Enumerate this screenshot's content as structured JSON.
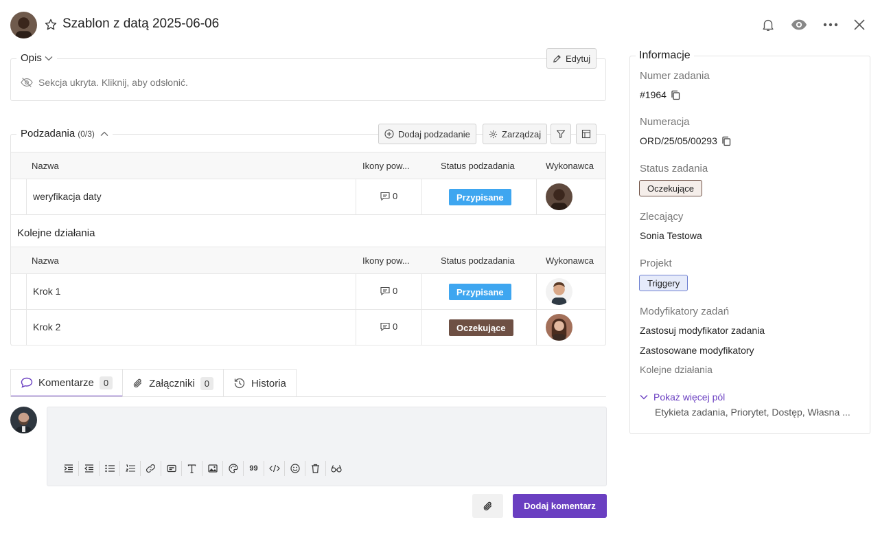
{
  "header": {
    "title": "Szablon z datą 2025-06-06"
  },
  "description": {
    "label": "Opis",
    "edit_label": "Edytuj",
    "hidden_text": "Sekcja ukryta. Kliknij, aby odsłonić."
  },
  "subtasks": {
    "label": "Podzadania",
    "count": "(0/3)",
    "add_label": "Dodaj podzadanie",
    "manage_label": "Zarządzaj",
    "columns": [
      "Nazwa",
      "Ikony pow...",
      "Status podzadania",
      "Wykonawca"
    ],
    "rows": [
      {
        "name": "weryfikacja daty",
        "comments": "0",
        "status": "Przypisane"
      }
    ]
  },
  "next_actions": {
    "label": "Kolejne działania",
    "columns": [
      "Nazwa",
      "Ikony pow...",
      "Status podzadania",
      "Wykonawca"
    ],
    "rows": [
      {
        "name": "Krok 1",
        "comments": "0",
        "status": "Przypisane"
      },
      {
        "name": "Krok 2",
        "comments": "0",
        "status": "Oczekujące"
      }
    ]
  },
  "tabs": [
    {
      "label": "Komentarze",
      "count": "0"
    },
    {
      "label": "Załączniki",
      "count": "0"
    },
    {
      "label": "Historia"
    }
  ],
  "comment": {
    "submit_label": "Dodaj komentarz",
    "toolbar_icons": [
      "indent-icon",
      "outdent-icon",
      "bullet-list-icon",
      "numbered-list-icon",
      "link-icon",
      "card-icon",
      "text-format-icon",
      "image-icon",
      "palette-icon",
      "quote-icon",
      "code-icon",
      "emoji-icon",
      "trash-icon",
      "preview-icon"
    ],
    "quote_glyph": "99"
  },
  "info": {
    "title": "Informacje",
    "task_number_label": "Numer zadania",
    "task_number": "#1964",
    "numbering_label": "Numeracja",
    "numbering": "ORD/25/05/00293",
    "status_label": "Status zadania",
    "status": "Oczekujące",
    "requester_label": "Zlecający",
    "requester": "Sonia Testowa",
    "project_label": "Projekt",
    "project": "Triggery",
    "modifiers_label": "Modyfikatory zadań",
    "apply_modifier": "Zastosuj modyfikator zadania",
    "applied_modifiers": "Zastosowane modyfikatory",
    "next_actions": "Kolejne działania",
    "show_more": "Pokaż więcej pól",
    "more_fields": "Etykieta zadania, Priorytet, Dostęp, Własna ..."
  },
  "colors": {
    "accent": "#6a3fc1",
    "assigned": "#3ea6f0",
    "pending": "#6e5044",
    "pending_tag_bg": "#f5eeea",
    "project_tag_bg": "#e6ebfa"
  }
}
